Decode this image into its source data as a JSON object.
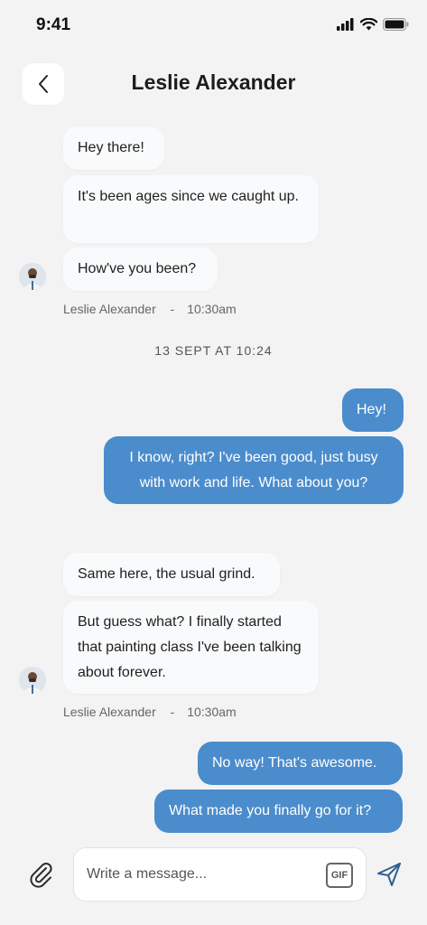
{
  "status_bar": {
    "time": "9:41"
  },
  "header": {
    "title": "Leslie Alexander"
  },
  "messages": {
    "m1": "Hey there!",
    "m2": "It's been ages since we caught up.",
    "m3": "How've you been?",
    "meta1_name": "Leslie Alexander",
    "meta1_sep": "-",
    "meta1_time": "10:30am",
    "divider": "13 SEPT AT 10:24",
    "m4": "Hey!",
    "m5": "I know, right? I've been good, just busy with work and life. What about you?",
    "m6": "Same here, the usual grind.",
    "m7": "But guess what? I finally started that painting class I've been talking about forever.",
    "meta2_name": "Leslie Alexander",
    "meta2_sep": "-",
    "meta2_time": "10:30am",
    "m8": "No way! That's awesome.",
    "m9": "What made you finally go for it?"
  },
  "composer": {
    "placeholder": "Write a message...",
    "gif_label": "GIF"
  },
  "colors": {
    "background": "#f3f3f3",
    "incoming_bubble": "#f9fafb",
    "outgoing_bubble": "#4b8ccc",
    "send_icon": "#2f5f8f"
  },
  "icons": [
    "cellular-signal-icon",
    "wifi-icon",
    "battery-icon",
    "back-arrow-icon",
    "paperclip-icon",
    "send-icon"
  ]
}
